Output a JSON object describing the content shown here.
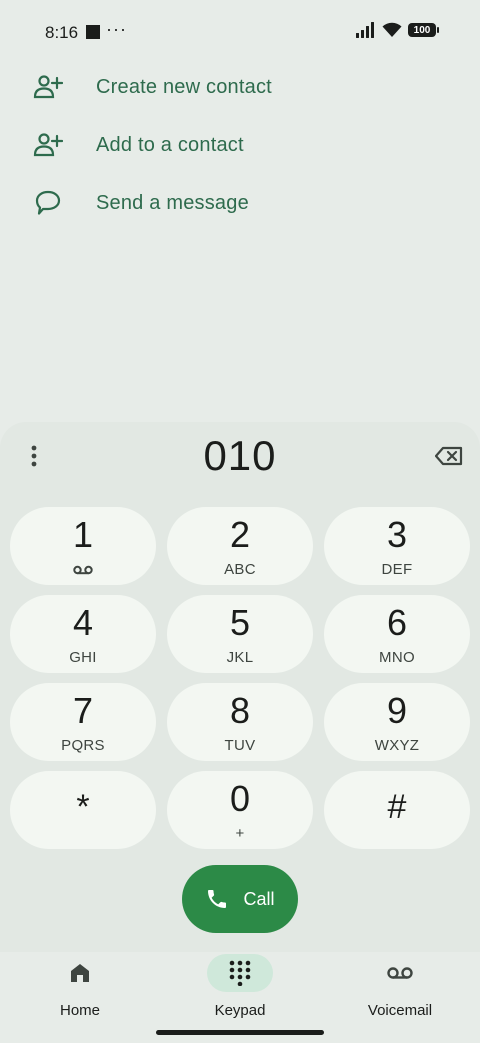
{
  "status_bar": {
    "time": "8:16",
    "dots": "···",
    "battery": "100"
  },
  "actions": [
    {
      "label": "Create new contact",
      "icon": "add-person-icon"
    },
    {
      "label": "Add to a contact",
      "icon": "add-person-icon"
    },
    {
      "label": "Send a message",
      "icon": "message-icon"
    }
  ],
  "dialer": {
    "number": "010"
  },
  "keys": [
    {
      "digit": "1",
      "letters": ""
    },
    {
      "digit": "2",
      "letters": "ABC"
    },
    {
      "digit": "3",
      "letters": "DEF"
    },
    {
      "digit": "4",
      "letters": "GHI"
    },
    {
      "digit": "5",
      "letters": "JKL"
    },
    {
      "digit": "6",
      "letters": "MNO"
    },
    {
      "digit": "7",
      "letters": "PQRS"
    },
    {
      "digit": "8",
      "letters": "TUV"
    },
    {
      "digit": "9",
      "letters": "WXYZ"
    },
    {
      "digit": "*",
      "letters": ""
    },
    {
      "digit": "0",
      "letters": "+"
    },
    {
      "digit": "#",
      "letters": ""
    }
  ],
  "call": {
    "label": "Call"
  },
  "nav": [
    {
      "label": "Home",
      "icon": "home-icon"
    },
    {
      "label": "Keypad",
      "icon": "keypad-icon",
      "active": true
    },
    {
      "label": "Voicemail",
      "icon": "voicemail-icon"
    }
  ],
  "colors": {
    "accent_text": "#2E6B4D",
    "call_button": "#2C8A47",
    "active_nav": "#CFE8DA",
    "key_background": "#F3F7F2",
    "sheet_background": "#E2E8E3",
    "page_background": "#E7ECE8"
  }
}
